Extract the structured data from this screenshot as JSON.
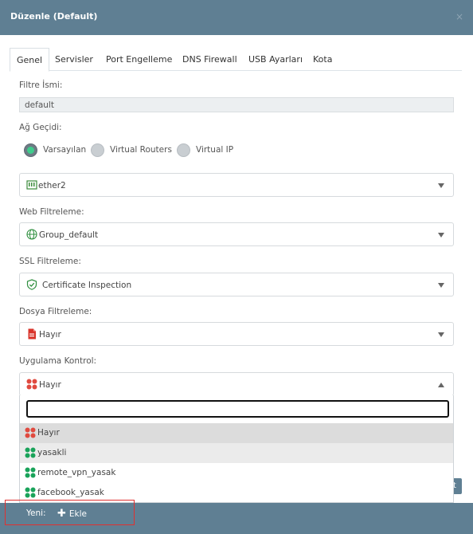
{
  "modal": {
    "title": "Düzenle (Default)",
    "close": "×"
  },
  "tabs": [
    {
      "label": "Genel",
      "active": true
    },
    {
      "label": "Servisler"
    },
    {
      "label": "Port Engelleme"
    },
    {
      "label": "DNS Firewall"
    },
    {
      "label": "USB Ayarları"
    },
    {
      "label": "Kota"
    }
  ],
  "filter_name": {
    "label": "Filtre İsmi:",
    "value": "default"
  },
  "gateway": {
    "label": "Ağ Geçidi:",
    "options": [
      "Varsayılan",
      "Virtual Routers",
      "Virtual IP"
    ],
    "selected": "Varsayılan",
    "interface": {
      "value": "ether2",
      "icon": "network-port-icon"
    }
  },
  "web_filter": {
    "label": "Web Filtreleme:",
    "value": "Group_default",
    "icon": "globe-icon"
  },
  "ssl_filter": {
    "label": "SSL Filtreleme:",
    "value": "Certificate Inspection",
    "icon": "shield-check-icon"
  },
  "file_filter": {
    "label": "Dosya Filtreleme:",
    "value": "Hayır",
    "icon": "pdf-file-icon"
  },
  "app_control": {
    "label": "Uygulama Kontrol:",
    "value": "Hayır",
    "icon": "app-grid-icon",
    "search_value": "",
    "options": [
      {
        "label": "Hayır",
        "color": "#e04a3f"
      },
      {
        "label": "yasakli",
        "color": "#1aa35a"
      },
      {
        "label": "remote_vpn_yasak",
        "color": "#1aa35a"
      },
      {
        "label": "facebook_yasak",
        "color": "#1aa35a"
      }
    ]
  },
  "footer": {
    "new_label": "Yeni:",
    "add_label": "Ekle"
  },
  "partial_button": {
    "label": "t"
  },
  "colors": {
    "header": "#5f7f93",
    "radio_on": "#3fcc8c",
    "highlight": "#e03030"
  }
}
